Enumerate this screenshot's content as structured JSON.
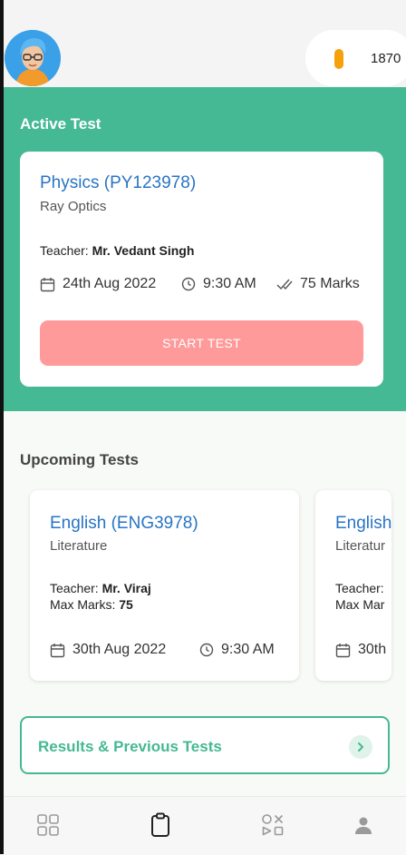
{
  "header": {
    "coins": "1870"
  },
  "active": {
    "section_title": "Active Test",
    "subject": "Physics (PY123978)",
    "topic": "Ray Optics",
    "teacher_label": "Teacher:",
    "teacher_name": "Mr. Vedant Singh",
    "date": "24th Aug 2022",
    "time": "9:30 AM",
    "marks": "75 Marks",
    "start_label": "START TEST"
  },
  "upcoming": {
    "section_title": "Upcoming Tests",
    "cards": [
      {
        "subject": "English (ENG3978)",
        "topic": "Literature",
        "teacher_label": "Teacher:",
        "teacher_name": "Mr. Viraj",
        "max_label": "Max Marks:",
        "max_value": "75",
        "date": "30th Aug 2022",
        "time": "9:30 AM"
      },
      {
        "subject": "English",
        "topic": "Literatur",
        "teacher_label": "Teacher:",
        "max_label": "Max Mar",
        "date": "30th"
      }
    ]
  },
  "results": {
    "label": "Results & Previous Tests"
  },
  "colors": {
    "accent": "#45b894",
    "link": "#2874c4",
    "start_button": "#ff9a9a",
    "coin": "#f5a10b"
  },
  "icons": {
    "nav": [
      "dashboard-icon",
      "clipboard-icon",
      "games-icon",
      "profile-icon"
    ],
    "meta": [
      "calendar-icon",
      "clock-icon",
      "check-icon"
    ]
  }
}
